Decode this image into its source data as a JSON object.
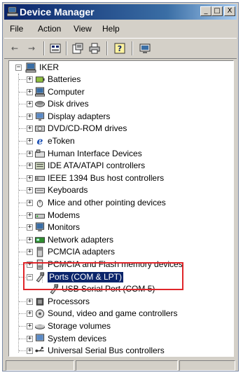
{
  "window": {
    "title": "Device Manager",
    "buttons": {
      "minimize": "_",
      "maximize": "□",
      "close": "X"
    }
  },
  "menu": [
    "File",
    "Action",
    "View",
    "Help"
  ],
  "toolbar": {
    "icons": [
      "back-icon",
      "forward-icon",
      "view-icon",
      "properties-icon",
      "print-icon",
      "help-icon",
      "monitor-icon"
    ],
    "back": "←",
    "forward": "→"
  },
  "tree": {
    "root": {
      "label": "IKER",
      "expander": "−",
      "icon": "computer-icon"
    },
    "items": [
      {
        "label": "Batteries",
        "expander": "+",
        "icon": "battery-icon"
      },
      {
        "label": "Computer",
        "expander": "+",
        "icon": "computer-icon"
      },
      {
        "label": "Disk drives",
        "expander": "+",
        "icon": "disk-drive-icon"
      },
      {
        "label": "Display adapters",
        "expander": "+",
        "icon": "display-adapter-icon"
      },
      {
        "label": "DVD/CD-ROM drives",
        "expander": "+",
        "icon": "dvd-drive-icon"
      },
      {
        "label": "eToken",
        "expander": "+",
        "icon": "etoken-icon"
      },
      {
        "label": "Human Interface Devices",
        "expander": "+",
        "icon": "hid-icon"
      },
      {
        "label": "IDE ATA/ATAPI controllers",
        "expander": "+",
        "icon": "ide-controller-icon"
      },
      {
        "label": "IEEE 1394 Bus host controllers",
        "expander": "+",
        "icon": "ieee1394-icon"
      },
      {
        "label": "Keyboards",
        "expander": "+",
        "icon": "keyboard-icon"
      },
      {
        "label": "Mice and other pointing devices",
        "expander": "+",
        "icon": "mouse-icon"
      },
      {
        "label": "Modems",
        "expander": "+",
        "icon": "modem-icon"
      },
      {
        "label": "Monitors",
        "expander": "+",
        "icon": "monitor-icon"
      },
      {
        "label": "Network adapters",
        "expander": "+",
        "icon": "network-adapter-icon"
      },
      {
        "label": "PCMCIA adapters",
        "expander": "+",
        "icon": "pcmcia-icon"
      },
      {
        "label": "PCMCIA and Flash memory devices",
        "expander": "+",
        "icon": "flash-memory-icon"
      },
      {
        "label": "Ports (COM & LPT)",
        "expander": "−",
        "icon": "port-icon",
        "selected": true
      },
      {
        "label": "USB Serial Port (COM  5)",
        "child": true,
        "icon": "port-icon"
      },
      {
        "label": "Processors",
        "expander": "+",
        "icon": "processor-icon"
      },
      {
        "label": "Sound, video and game controllers",
        "expander": "+",
        "icon": "sound-icon"
      },
      {
        "label": "Storage volumes",
        "expander": "+",
        "icon": "storage-volume-icon"
      },
      {
        "label": "System devices",
        "expander": "+",
        "icon": "system-device-icon"
      },
      {
        "label": "Universal Serial Bus controllers",
        "expander": "+",
        "icon": "usb-icon"
      }
    ]
  },
  "colors": {
    "title_bar": "#0a246a",
    "selection": "#0a246a",
    "highlight_box": "#e0262a",
    "window_face": "#d4d0c8"
  }
}
